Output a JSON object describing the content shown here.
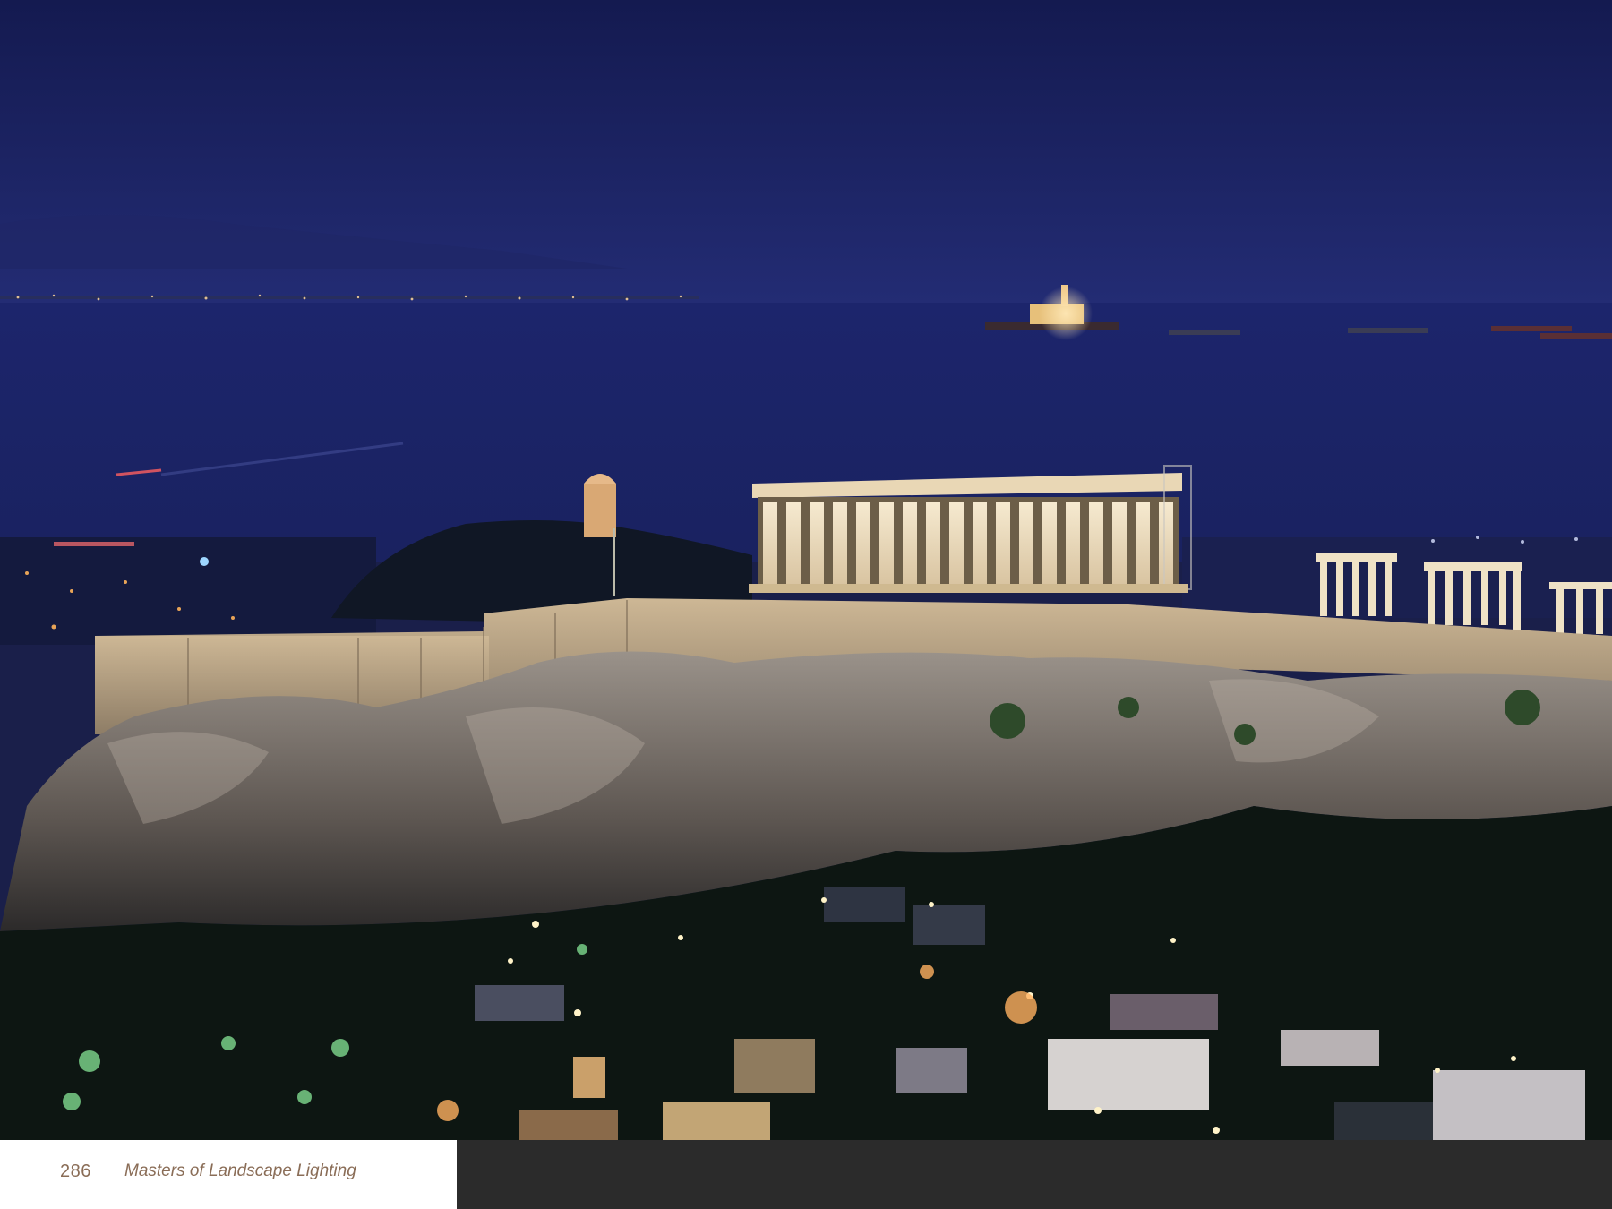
{
  "footer": {
    "page_number": "286",
    "book_title": "Masters of Landscape Lighting"
  },
  "photo": {
    "subject": "",
    "colors": {
      "sky_top": "#161d55",
      "sky_horizon": "#222b72",
      "sea": "#1b246a",
      "limestone_lit": "#d9c7a8",
      "temple_glow": "#f4e6c8",
      "rock": "#6a625c",
      "foliage_dark": "#0d1612",
      "footer_panel": "#2b2b2b",
      "footer_text": "#8a6d57"
    }
  }
}
